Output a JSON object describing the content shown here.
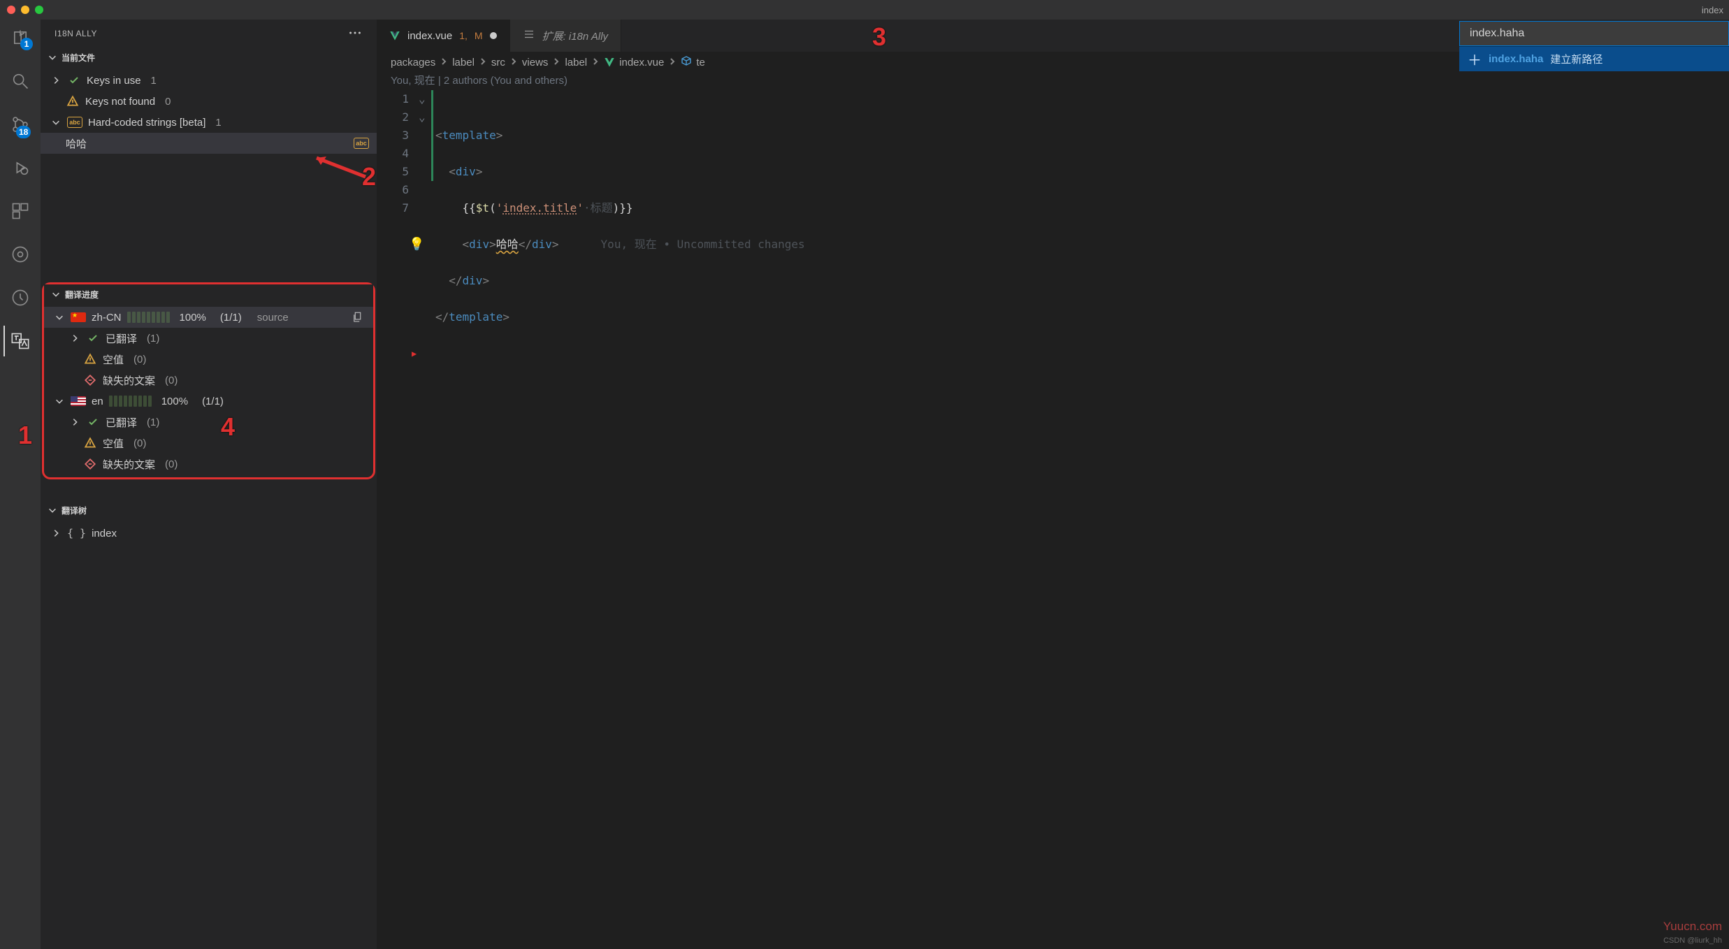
{
  "window": {
    "title": "index"
  },
  "activity": {
    "explorer_badge": "1",
    "scm_badge": "18"
  },
  "panel": {
    "title": "I18N ALLY",
    "section_current": "当前文件",
    "items": {
      "keys_in_use": {
        "label": "Keys in use",
        "count": "1"
      },
      "keys_not_found": {
        "label": "Keys not found",
        "count": "0"
      },
      "hard_coded": {
        "label": "Hard-coded strings [beta]",
        "count": "1"
      },
      "haha": {
        "label": "哈哈"
      },
      "abc_badge": "abc"
    },
    "section_progress": "翻译进度",
    "zh": {
      "name": "zh-CN",
      "pct": "100%",
      "ratio": "(1/1)",
      "source": "source",
      "translated": {
        "label": "已翻译",
        "count": "(1)"
      },
      "empty": {
        "label": "空值",
        "count": "(0)"
      },
      "missing": {
        "label": "缺失的文案",
        "count": "(0)"
      }
    },
    "en": {
      "name": "en",
      "pct": "100%",
      "ratio": "(1/1)",
      "translated": {
        "label": "已翻译",
        "count": "(1)"
      },
      "empty": {
        "label": "空值",
        "count": "(0)"
      },
      "missing": {
        "label": "缺失的文案",
        "count": "(0)"
      }
    },
    "section_tree": "翻译树",
    "tree_root": "index"
  },
  "tabs": {
    "index": {
      "name": "index.vue",
      "hint_num": "1,",
      "hint_m": "M"
    },
    "ext": {
      "name": "扩展: i18n Ally"
    }
  },
  "breadcrumbs": {
    "p0": "packages",
    "p1": "label",
    "p2": "src",
    "p3": "views",
    "p4": "label",
    "p5": "index.vue",
    "p6": "te"
  },
  "editor": {
    "authors": "You, 现在 | 2 authors (You and others)",
    "lines": {
      "l1": "1",
      "l2": "2",
      "l3": "3",
      "l4": "4",
      "l5": "5",
      "l6": "6",
      "l7": "7"
    },
    "code": {
      "template": "template",
      "div": "div",
      "t_fn": "$t",
      "key": "index.title",
      "key_hint": "标题",
      "haha": "哈哈",
      "blame": "You, 现在 • Uncommitted changes"
    }
  },
  "quickinput": {
    "value": "index.haha",
    "row_main": "index.haha",
    "row_desc": "建立新路径"
  },
  "annotations": {
    "a1": "1",
    "a2": "2",
    "a3": "3",
    "a4": "4"
  },
  "watermark": "Yuucn.com",
  "credit": "CSDN @liurk_hh"
}
